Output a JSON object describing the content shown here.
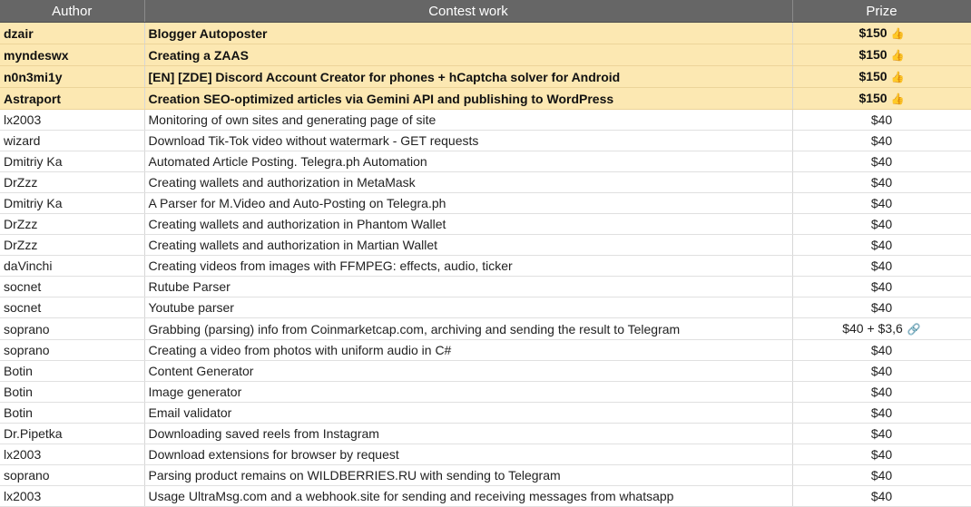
{
  "headers": {
    "author": "Author",
    "work": "Contest work",
    "prize": "Prize"
  },
  "rows": [
    {
      "author": "dzair",
      "work": "Blogger Autoposter",
      "prize": "$150",
      "top": true
    },
    {
      "author": "myndeswx",
      "work": "Creating a ZAAS",
      "prize": "$150",
      "top": true
    },
    {
      "author": "n0n3mi1y",
      "work": "[EN] [ZDE] Discord Account Creator for phones + hCaptcha solver for Android",
      "prize": "$150",
      "top": true
    },
    {
      "author": "Astraport",
      "work": "Creation SEO-optimized articles via Gemini API and publishing to WordPress",
      "prize": "$150",
      "top": true
    },
    {
      "author": "lx2003",
      "work": "Monitoring of own sites and generating page of site",
      "prize": "$40"
    },
    {
      "author": "wizard",
      "work": "Download Tik-Tok video without watermark - GET requests",
      "prize": "$40"
    },
    {
      "author": "Dmitriy Ka",
      "work": "Automated Article Posting. Telegra.ph Automation",
      "prize": "$40"
    },
    {
      "author": "DrZzz",
      "work": "Creating wallets and authorization in MetaMask",
      "prize": "$40"
    },
    {
      "author": "Dmitriy Ka",
      "work": "A Parser for M.Video and Auto-Posting on Telegra.ph",
      "prize": "$40"
    },
    {
      "author": "DrZzz",
      "work": "Creating wallets and authorization in Phantom Wallet",
      "prize": "$40"
    },
    {
      "author": "DrZzz",
      "work": "Creating wallets and authorization in Martian Wallet",
      "prize": "$40"
    },
    {
      "author": "daVinchi",
      "work": "Creating videos from images with FFMPEG: effects, audio, ticker",
      "prize": "$40"
    },
    {
      "author": "socnet",
      "work": "Rutube Parser",
      "prize": "$40"
    },
    {
      "author": "socnet",
      "work": "Youtube parser",
      "prize": "$40"
    },
    {
      "author": "soprano",
      "work": "Grabbing (parsing) info from Coinmarketcap.com, archiving and sending the result to Telegram",
      "prize": "$40 + $3,6",
      "link": true
    },
    {
      "author": "soprano",
      "work": "Creating a video from photos with uniform audio in C#",
      "prize": "$40"
    },
    {
      "author": "Botin",
      "work": "Content Generator",
      "prize": "$40"
    },
    {
      "author": "Botin",
      "work": "Image generator",
      "prize": "$40"
    },
    {
      "author": "Botin",
      "work": "Email validator",
      "prize": "$40"
    },
    {
      "author": "Dr.Pipetka",
      "work": "Downloading saved reels from Instagram",
      "prize": "$40"
    },
    {
      "author": "lx2003",
      "work": "Download extensions for browser by request",
      "prize": "$40"
    },
    {
      "author": "soprano",
      "work": "Parsing product remains on WILDBERRIES.RU with sending to Telegram",
      "prize": "$40"
    },
    {
      "author": "lx2003",
      "work": "Usage UltraMsg.com and a webhook.site for sending and receiving messages from whatsapp",
      "prize": "$40"
    }
  ],
  "icons": {
    "thumb": "thumbs-up-icon",
    "link": "link-icon"
  },
  "colors": {
    "header_bg": "#666666",
    "top_row_bg": "#fce8b2",
    "thumb": "#e7a325"
  }
}
